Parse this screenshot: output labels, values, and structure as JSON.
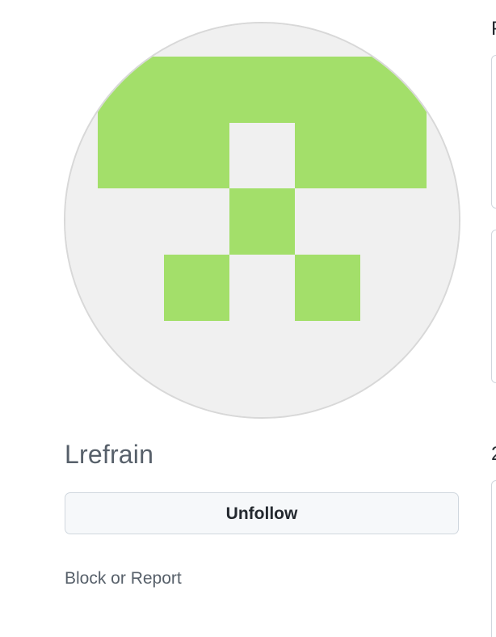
{
  "profile": {
    "username": "Lrefrain",
    "avatar_color": "#a3df6a",
    "avatar_background": "#f0f0f0",
    "avatar_name": "identicon-avatar"
  },
  "actions": {
    "unfollow_label": "Unfollow",
    "block_report_label": "Block or Report"
  },
  "right_panel": {
    "heading_top_char": "P",
    "heading_bottom_char": "2"
  }
}
